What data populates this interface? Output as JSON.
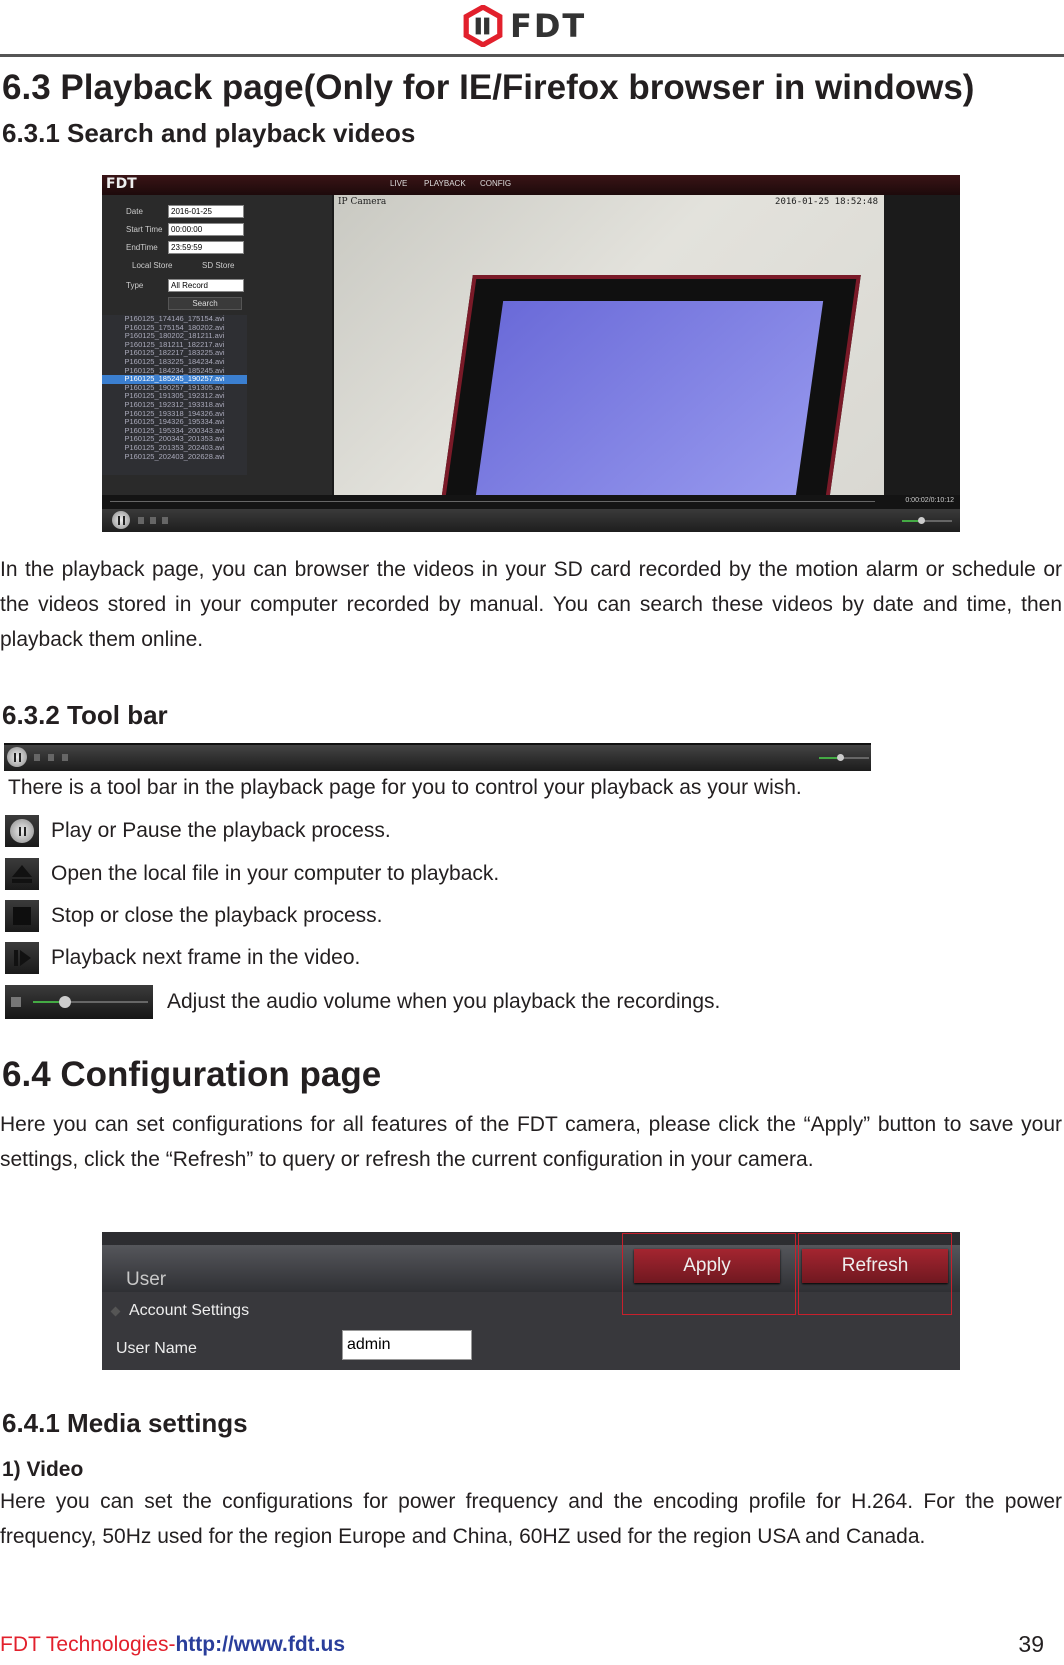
{
  "header": {
    "logo_text": "FDT",
    "brand_colors": {
      "red": "#e2202c",
      "dark": "#333333"
    }
  },
  "section_6_3": {
    "title": "6.3 Playback page(Only for IE/Firefox browser in windows)",
    "sub_6_3_1": {
      "title": "6.3.1 Search and playback videos",
      "screenshot": {
        "brand": "FDT",
        "nav": [
          "LIVE",
          "PLAYBACK",
          "CONFIG"
        ],
        "form": {
          "date_label": "Date",
          "date_value": "2016-01-25",
          "start_label": "Start Time",
          "start_value": "00:00:00",
          "end_label": "EndTime",
          "end_value": "23:59:59",
          "local_store": "Local Store",
          "sd_store": "SD Store",
          "type_label": "Type",
          "type_value": "All Record",
          "search_button": "Search"
        },
        "files": [
          "P160125_174146_175154.avi",
          "P160125_175154_180202.avi",
          "P160125_180202_181211.avi",
          "P160125_181211_182217.avi",
          "P160125_182217_183225.avi",
          "P160125_183225_184234.avi",
          "P160125_184234_185245.avi",
          "P160125_185245_190257.avi",
          "P160125_190257_191305.avi",
          "P160125_191305_192312.avi",
          "P160125_192312_193318.avi",
          "P160125_193318_194326.avi",
          "P160125_194326_195334.avi",
          "P160125_195334_200343.avi",
          "P160125_200343_201353.avi",
          "P160125_201353_202403.avi",
          "P160125_202403_202628.avi"
        ],
        "selected_index": 7,
        "camera_title": "IP Camera",
        "camera_timestamp": "2016-01-25 18:52:48",
        "playback_time": "0:00:02/0:10:12"
      },
      "description": "In the playback page, you can browser the videos in your SD card recorded by the motion alarm or schedule or the videos stored in your computer recorded by manual. You can search these videos by date and time, then playback them online."
    },
    "sub_6_3_2": {
      "title": "6.3.2 Tool bar",
      "intro": "There is a tool bar in the playback page for you to control your playback as your wish.",
      "items": [
        {
          "icon": "pause-icon",
          "text": "Play or Pause the playback process."
        },
        {
          "icon": "eject-icon",
          "text": "Open the local file in your computer to playback."
        },
        {
          "icon": "stop-icon",
          "text": "Stop or close the playback process."
        },
        {
          "icon": "next-frame-icon",
          "text": "Playback next frame in the video."
        },
        {
          "icon": "volume-slider",
          "text": "Adjust the audio volume when you playback the recordings."
        }
      ]
    }
  },
  "section_6_4": {
    "title": "6.4 Configuration page",
    "description": "Here you can set configurations for all features of the FDT camera, please click the “Apply” button to save your settings, click the “Refresh” to query or refresh the current configuration in your camera.",
    "screenshot": {
      "section_label": "User",
      "apply_button": "Apply",
      "refresh_button": "Refresh",
      "group_label": "Account Settings",
      "username_label": "User Name",
      "username_value": "admin"
    },
    "sub_6_4_1": {
      "title": "6.4.1 Media settings",
      "video_heading": "1) Video",
      "video_text": "Here you can set the configurations for power frequency and the encoding profile for H.264. For the power frequency, 50Hz used for the region Europe and China, 60HZ used for the region USA and Canada."
    }
  },
  "footer": {
    "company": "FDT Technologies-",
    "url": "http://www.fdt.us",
    "page_number": "39"
  }
}
